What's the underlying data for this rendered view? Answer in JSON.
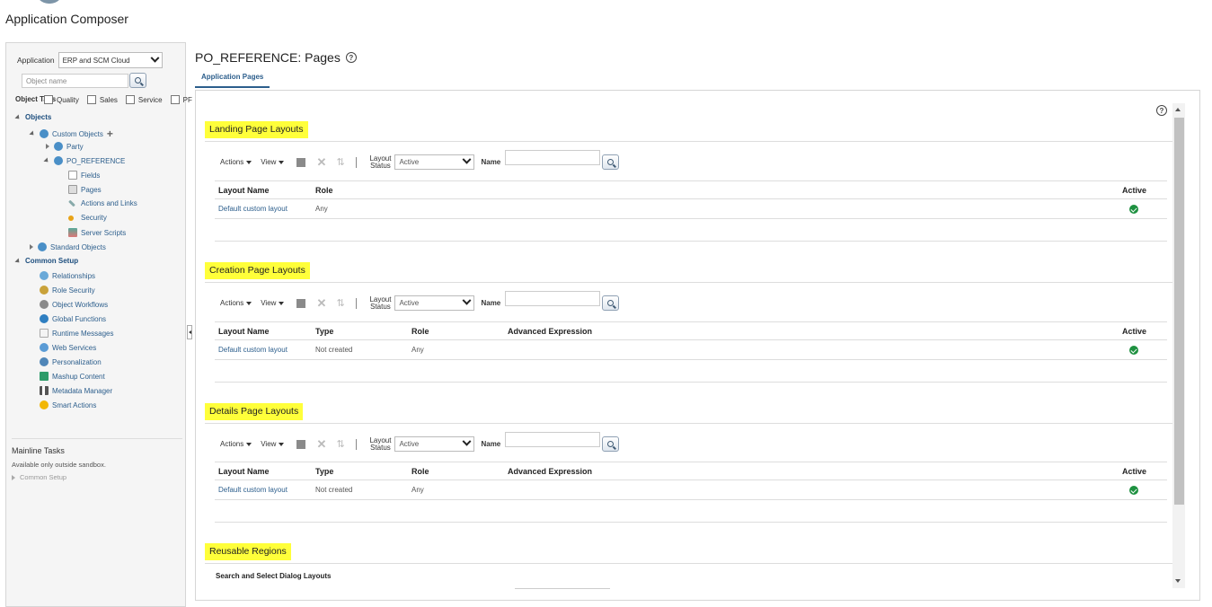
{
  "app": {
    "title": "Application Composer"
  },
  "left": {
    "application_label": "Application",
    "application_value": "ERP and SCM Cloud",
    "object_name_placeholder": "Object name",
    "object_tags_label": "Object Tags",
    "tags": [
      "Quality",
      "Sales",
      "Service",
      "PF"
    ],
    "tree": {
      "objects": "Objects",
      "custom_objects": "Custom Objects",
      "party": "Party",
      "po_reference": "PO_REFERENCE",
      "fields": "Fields",
      "pages": "Pages",
      "actions_links": "Actions and Links",
      "security": "Security",
      "server_scripts": "Server Scripts",
      "standard_objects": "Standard Objects",
      "common_setup": "Common Setup",
      "relationships": "Relationships",
      "role_security": "Role Security",
      "object_workflows": "Object Workflows",
      "global_functions": "Global Functions",
      "runtime_messages": "Runtime Messages",
      "web_services": "Web Services",
      "personalization": "Personalization",
      "mashup_content": "Mashup Content",
      "metadata_manager": "Metadata Manager",
      "smart_actions": "Smart Actions"
    },
    "mainline": {
      "title": "Mainline Tasks",
      "subtitle": "Available only outside sandbox.",
      "common_setup": "Common Setup"
    }
  },
  "main": {
    "page_title": "PO_REFERENCE: Pages",
    "help_glyph": "?",
    "tab": "Application Pages",
    "toolbar": {
      "actions": "Actions",
      "view": "View",
      "layout_status_line1": "Layout",
      "layout_status_line2": "Status",
      "layout_status_value": "Active",
      "name_label": "Name"
    },
    "landing": {
      "title": "Landing Page Layouts",
      "headers": {
        "layout_name": "Layout Name",
        "role": "Role",
        "active": "Active"
      },
      "row": {
        "layout_name": "Default custom layout",
        "role": "Any"
      }
    },
    "creation": {
      "title": "Creation Page Layouts",
      "headers": {
        "layout_name": "Layout Name",
        "type": "Type",
        "role": "Role",
        "adv": "Advanced Expression",
        "active": "Active"
      },
      "row": {
        "layout_name": "Default custom layout",
        "type": "Not created",
        "role": "Any"
      }
    },
    "details": {
      "title": "Details Page Layouts",
      "headers": {
        "layout_name": "Layout Name",
        "type": "Type",
        "role": "Role",
        "adv": "Advanced Expression",
        "active": "Active"
      },
      "row": {
        "layout_name": "Default custom layout",
        "type": "Not created",
        "role": "Any"
      }
    },
    "reusable": {
      "title": "Reusable Regions",
      "subtitle": "Search and Select Dialog Layouts"
    }
  },
  "colors": {
    "highlight": "#ffff3a",
    "link": "#2c5e8c",
    "active_check": "#1e9140"
  }
}
